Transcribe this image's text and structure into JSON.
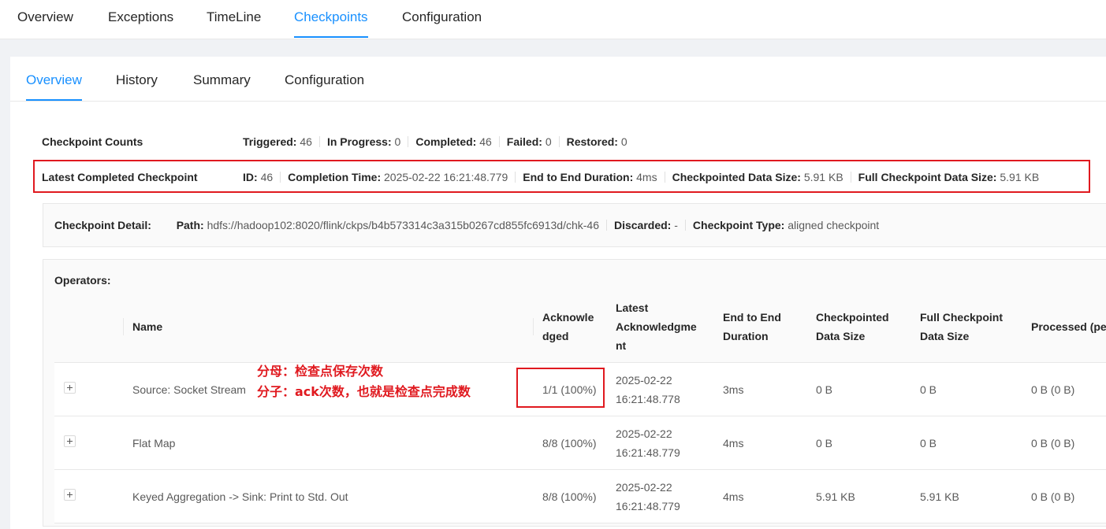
{
  "top_tabs": [
    "Overview",
    "Exceptions",
    "TimeLine",
    "Checkpoints",
    "Configuration"
  ],
  "top_active": "Checkpoints",
  "sub_tabs": [
    "Overview",
    "History",
    "Summary",
    "Configuration"
  ],
  "sub_active": "Overview",
  "counts": {
    "title": "Checkpoint Counts",
    "triggered_label": "Triggered:",
    "triggered": "46",
    "in_progress_label": "In Progress:",
    "in_progress": "0",
    "completed_label": "Completed:",
    "completed": "46",
    "failed_label": "Failed:",
    "failed": "0",
    "restored_label": "Restored:",
    "restored": "0"
  },
  "latest": {
    "title": "Latest Completed Checkpoint",
    "id_label": "ID:",
    "id": "46",
    "completion_time_label": "Completion Time:",
    "completion_time": "2025-02-22 16:21:48.779",
    "e2e_label": "End to End Duration:",
    "e2e": "4ms",
    "data_size_label": "Checkpointed Data Size:",
    "data_size": "5.91 KB",
    "full_size_label": "Full Checkpoint Data Size:",
    "full_size": "5.91 KB"
  },
  "detail": {
    "title": "Checkpoint Detail:",
    "path_label": "Path:",
    "path": "hdfs://hadoop102:8020/flink/ckps/b4b573314c3a315b0267cd855fc6913d/chk-46",
    "discarded_label": "Discarded:",
    "discarded": "-",
    "type_label": "Checkpoint Type:",
    "type": "aligned checkpoint"
  },
  "operators": {
    "label": "Operators:",
    "columns": {
      "name": "Name",
      "ack": "Acknowle dged",
      "latest_ack": "Latest Acknowledgme nt",
      "e2e": "End to End Duration",
      "ckpt_size": "Checkpointed Data Size",
      "full_size": "Full Checkpoint Data Size",
      "processed": "Processed (pe in-flight data"
    },
    "rows": [
      {
        "name": "Source: Socket Stream",
        "ack": "1/1 (100%)",
        "latest_ack_date": "2025-02-22",
        "latest_ack_time": "16:21:48.778",
        "e2e": "3ms",
        "ckpt_size": "0 B",
        "full_size": "0 B",
        "processed": "0 B (0 B)"
      },
      {
        "name": "Flat Map",
        "ack": "8/8 (100%)",
        "latest_ack_date": "2025-02-22",
        "latest_ack_time": "16:21:48.779",
        "e2e": "4ms",
        "ckpt_size": "0 B",
        "full_size": "0 B",
        "processed": "0 B (0 B)"
      },
      {
        "name": "Keyed Aggregation -> Sink: Print to Std. Out",
        "ack": "8/8 (100%)",
        "latest_ack_date": "2025-02-22",
        "latest_ack_time": "16:21:48.779",
        "e2e": "4ms",
        "ckpt_size": "5.91 KB",
        "full_size": "5.91 KB",
        "processed": "0 B (0 B)"
      }
    ]
  },
  "annotations": {
    "line1": "分母：检查点保存次数",
    "line2": "分子：ack次数，也就是检查点完成数"
  },
  "colors": {
    "accent": "#1890ff",
    "highlight": "#e0191f"
  }
}
